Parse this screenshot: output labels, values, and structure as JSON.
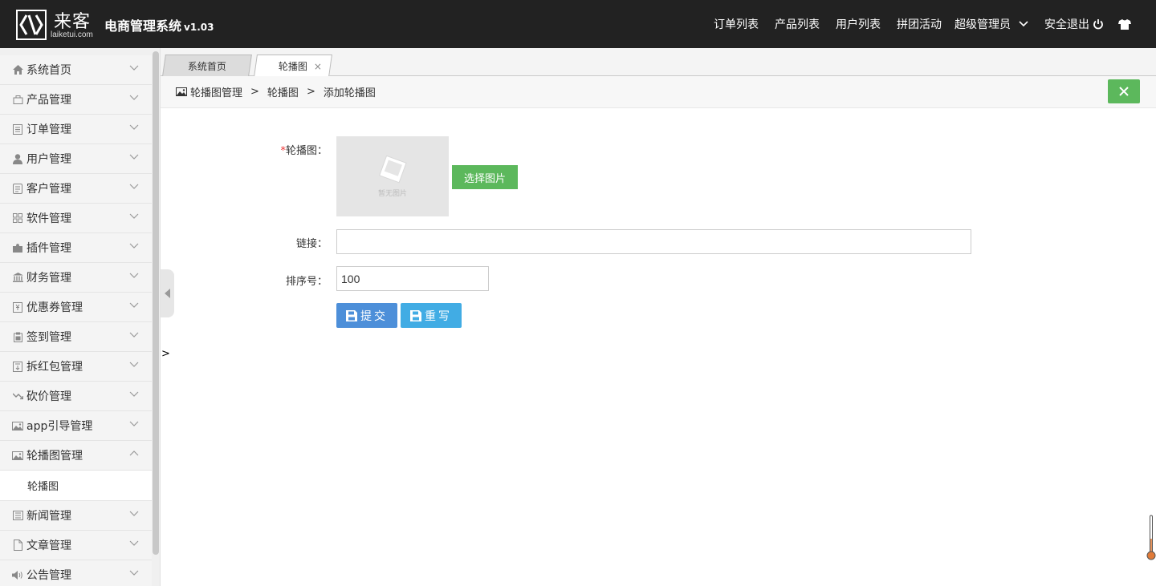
{
  "brand": {
    "logo_cn": "来客",
    "logo_en": "laiketui.com",
    "title": "电商管理系统",
    "version": "v1.03"
  },
  "topnav": {
    "items": [
      "订单列表",
      "产品列表",
      "用户列表",
      "拼团活动"
    ],
    "admin": "超级管理员",
    "logout": "安全退出"
  },
  "sidebar": {
    "items": [
      {
        "label": "系统首页",
        "icon": "home-icon"
      },
      {
        "label": "产品管理",
        "icon": "bag-icon"
      },
      {
        "label": "订单管理",
        "icon": "list-icon"
      },
      {
        "label": "用户管理",
        "icon": "user-icon"
      },
      {
        "label": "客户管理",
        "icon": "customer-icon"
      },
      {
        "label": "软件管理",
        "icon": "grid-icon"
      },
      {
        "label": "插件管理",
        "icon": "puzzle-icon"
      },
      {
        "label": "财务管理",
        "icon": "bank-icon"
      },
      {
        "label": "优惠券管理",
        "icon": "coupon-icon"
      },
      {
        "label": "签到管理",
        "icon": "clipboard-icon"
      },
      {
        "label": "拆红包管理",
        "icon": "redpacket-icon"
      },
      {
        "label": "砍价管理",
        "icon": "trend-icon"
      },
      {
        "label": "app引导管理",
        "icon": "image-icon"
      },
      {
        "label": "轮播图管理",
        "icon": "image-icon"
      },
      {
        "label": "新闻管理",
        "icon": "news-icon"
      },
      {
        "label": "文章管理",
        "icon": "file-icon"
      },
      {
        "label": "公告管理",
        "icon": "volume-icon"
      }
    ],
    "sub_item": "轮播图"
  },
  "tabs": {
    "home": "系统首页",
    "active": "轮播图",
    "close": "×"
  },
  "breadcrumb": {
    "root": "轮播图管理",
    "middle": "轮播图",
    "current": "添加轮播图",
    "sep": ">"
  },
  "form": {
    "image_label": "轮播图：",
    "required_mark": "*",
    "no_image_text": "暂无图片",
    "pick_button": "选择图片",
    "link_label": "链接：",
    "link_value": "",
    "sort_label": "排序号：",
    "sort_value": "100",
    "submit": "提交",
    "reset": "重写"
  },
  "stray_text": ">",
  "colors": {
    "topbar": "#222222",
    "success": "#5cb85c",
    "primary": "#4d8fd9",
    "info": "#41ace4"
  }
}
